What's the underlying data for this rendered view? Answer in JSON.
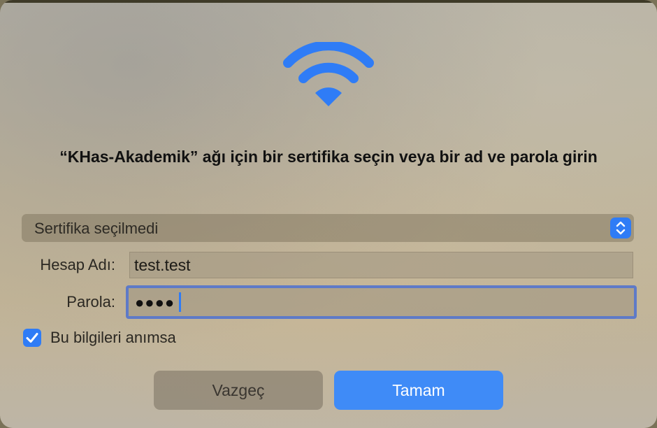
{
  "dialog": {
    "icon": "wifi-icon",
    "title": "“KHas-Akademik” ağı için bir sertifika seçin veya bir ad ve parola girin"
  },
  "certificate": {
    "selected": "Sertifika seçilmedi",
    "icon": "chevron-up-down-icon"
  },
  "account": {
    "label": "Hesap Adı:",
    "value": "test.test"
  },
  "password": {
    "label": "Parola:",
    "masked_value": "●●●●"
  },
  "remember": {
    "label": "Bu bilgileri anımsa",
    "checked": true
  },
  "buttons": {
    "cancel": "Vazgeç",
    "ok": "Tamam"
  },
  "colors": {
    "accent": "#2f7cf6"
  }
}
